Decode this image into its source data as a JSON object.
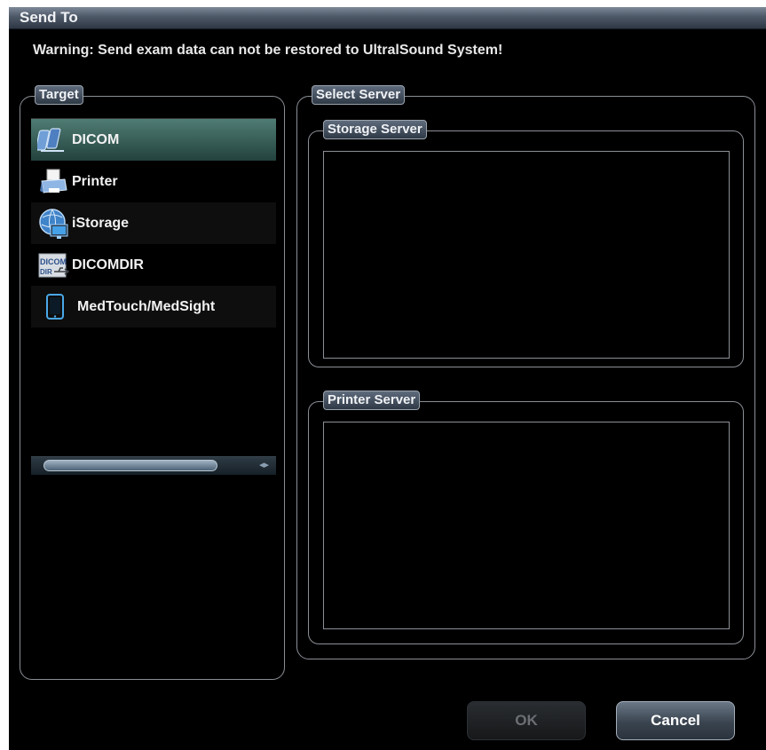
{
  "dialog": {
    "title": "Send To",
    "warning": "Warning: Send exam data can not be restored to UltralSound System!"
  },
  "target": {
    "legend": "Target",
    "items": [
      {
        "label": "DICOM",
        "icon": "dicom-network-icon",
        "selected": true
      },
      {
        "label": "Printer",
        "icon": "printer-icon",
        "selected": false
      },
      {
        "label": "iStorage",
        "icon": "istorage-globe-icon",
        "selected": false
      },
      {
        "label": "DICOMDIR",
        "icon": "dicomdir-usb-icon",
        "selected": false
      },
      {
        "label": "MedTouch/MedSight",
        "icon": "tablet-icon",
        "selected": false
      }
    ]
  },
  "select_server": {
    "legend": "Select Server",
    "storage_legend": "Storage Server",
    "printer_legend": "Printer Server"
  },
  "buttons": {
    "ok": "OK",
    "cancel": "Cancel"
  },
  "colors": {
    "selected_row": "#3f6b64",
    "title_bar": "#4d5867",
    "background": "#000000"
  }
}
